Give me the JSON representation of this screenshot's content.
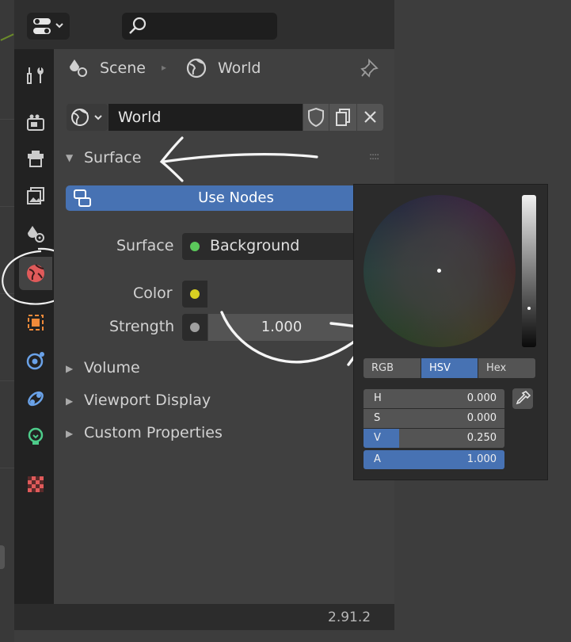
{
  "header": {
    "search_placeholder": ""
  },
  "breadcrumb": {
    "scene_label": "Scene",
    "world_label": "World"
  },
  "world_block": {
    "name": "World"
  },
  "surface_panel": {
    "title": "Surface",
    "use_nodes_label": "Use Nodes",
    "surface_label": "Surface",
    "surface_value": "Background",
    "color_label": "Color",
    "strength_label": "Strength",
    "strength_value": "1.000"
  },
  "collapsed_panels": {
    "volume": "Volume",
    "viewport_display": "Viewport Display",
    "custom_properties": "Custom Properties"
  },
  "status": {
    "version": "2.91.2"
  },
  "color_picker": {
    "modes": [
      "RGB",
      "HSV",
      "Hex"
    ],
    "active_mode": "HSV",
    "fields": [
      {
        "label": "H",
        "value": "0.000"
      },
      {
        "label": "S",
        "value": "0.000"
      },
      {
        "label": "V",
        "value": "0.250"
      },
      {
        "label": "A",
        "value": "1.000"
      }
    ]
  },
  "colors": {
    "accent": "#4772b3",
    "surface_dot": "#5bc85b",
    "color_dot": "#d8d022",
    "strength_dot": "#a0a0a0",
    "world_tab": "#e05a5a"
  }
}
